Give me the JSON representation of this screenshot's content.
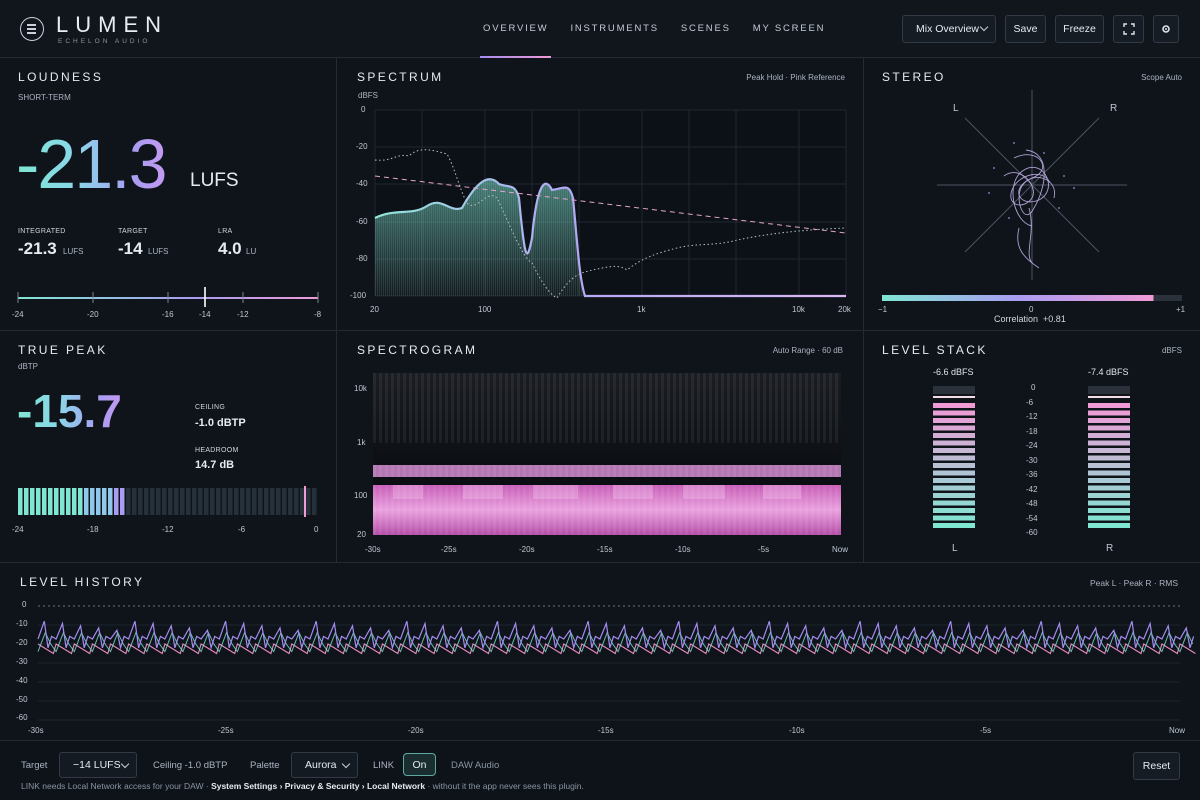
{
  "header": {
    "brand": "LUMEN",
    "brand_sub": "ECHELON AUDIO",
    "nav": [
      "OVERVIEW",
      "INSTRUMENTS",
      "SCENES",
      "MY SCREEN"
    ],
    "active_nav": "OVERVIEW",
    "preset_select": "Mix Overview",
    "save_label": "Save",
    "freeze_label": "Freeze"
  },
  "loudness": {
    "title": "LOUDNESS",
    "subtitle": "SHORT-TERM",
    "value": "-21.3",
    "unit": "LUFS",
    "integrated_label": "INTEGRATED",
    "integrated_value": "-21.3",
    "integrated_unit": "LUFS",
    "target_label": "TARGET",
    "target_value": "-14",
    "target_unit": "LUFS",
    "lra_label": "LRA",
    "lra_value": "4.0",
    "lra_unit": "LU",
    "scale_ticks": [
      "-24",
      "-20",
      "-16",
      "-14",
      "-12",
      "-8"
    ]
  },
  "spectrum": {
    "title": "SPECTRUM",
    "mode": "Peak Hold · Pink Reference",
    "y_unit": "dBFS",
    "y_ticks": [
      "0",
      "-20",
      "-40",
      "-60",
      "-80",
      "-100"
    ],
    "x_ticks": [
      "20",
      "100",
      "1k",
      "10k",
      "20k"
    ]
  },
  "stereo": {
    "title": "STEREO",
    "mode": "Scope Auto",
    "left_label": "L",
    "right_label": "R",
    "corr_ticks": [
      "−1",
      "0",
      "+1"
    ],
    "correlation_label": "Correlation",
    "correlation_value": "+0.81"
  },
  "true_peak": {
    "title": "TRUE PEAK",
    "subtitle": "dBTP",
    "value": "-15.7",
    "ceiling_label": "CEILING",
    "ceiling_value": "-1.0 dBTP",
    "headroom_label": "HEADROOM",
    "headroom_value": "14.7 dB",
    "scale_ticks": [
      "-24",
      "-18",
      "-12",
      "-6",
      "0"
    ]
  },
  "spectrogram": {
    "title": "SPECTROGRAM",
    "mode": "Auto Range · 60 dB",
    "y_ticks": [
      "10k",
      "1k",
      "100",
      "20"
    ],
    "x_ticks": [
      "-30s",
      "-25s",
      "-20s",
      "-15s",
      "-10s",
      "-5s",
      "Now"
    ]
  },
  "level_stack": {
    "title": "LEVEL STACK",
    "unit": "dBFS",
    "left_value": "-6.6 dBFS",
    "right_value": "-7.4 dBFS",
    "scale": [
      "0",
      "-6",
      "-12",
      "-18",
      "-24",
      "-30",
      "-36",
      "-42",
      "-48",
      "-54",
      "-60"
    ],
    "left_label": "L",
    "right_label": "R"
  },
  "level_history": {
    "title": "LEVEL HISTORY",
    "legend": "Peak L  ·  Peak R  ·  RMS",
    "y_ticks": [
      "0",
      "-10",
      "-20",
      "-30",
      "-40",
      "-50",
      "-60"
    ],
    "x_ticks": [
      "-30s",
      "-25s",
      "-20s",
      "-15s",
      "-10s",
      "-5s",
      "Now"
    ]
  },
  "footer": {
    "target_label": "Target",
    "target_value": "−14 LUFS",
    "ceiling_text": "Ceiling -1.0 dBTP",
    "palette_label": "Palette",
    "palette_value": "Aurora",
    "link_label": "LINK",
    "link_toggle": "On",
    "daw_label": "DAW Audio",
    "reset_label": "Reset",
    "note_1": "LINK needs Local Network access for your DAW · ",
    "note_settings": "System Settings",
    "note_arrow1": " › ",
    "note_privacy": "Privacy & Security",
    "note_arrow2": " › ",
    "note_network": "Local Network",
    "note_2": " · without it the app never sees this plugin."
  },
  "colors": {
    "accent_teal": "#7fe6d2",
    "accent_violet": "#a58cf0",
    "accent_pink": "#f09ad6"
  }
}
